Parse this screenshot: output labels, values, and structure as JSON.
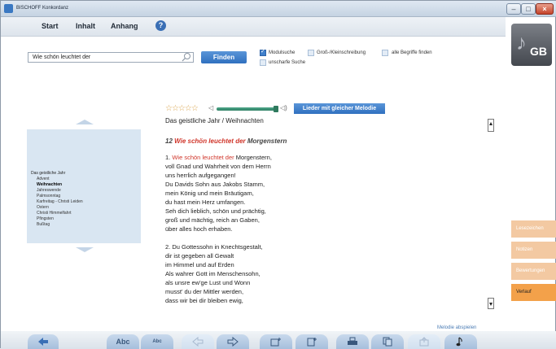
{
  "window": {
    "title": "BISCHOFF Konkordanz"
  },
  "menu": {
    "start": "Start",
    "inhalt": "Inhalt",
    "anhang": "Anhang"
  },
  "logo": {
    "text": "GB"
  },
  "search": {
    "value": "Wie schön leuchtet der",
    "find_label": "Finden"
  },
  "options": {
    "modulsuche": "Modulsuche",
    "gross_klein": "Groß-/Kleinschreibung",
    "alle_begriffe": "alle Begriffe finden",
    "unscharfe": "unscharfe Suche"
  },
  "sidebar": {
    "heading": "Das geistliche Jahr",
    "items": [
      {
        "label": "Advent",
        "active": false
      },
      {
        "label": "Weihnachten",
        "active": true
      },
      {
        "label": "Jahreswende",
        "active": false
      },
      {
        "label": "Palmsonntag",
        "active": false
      },
      {
        "label": "Karfreitag - Christi Leiden",
        "active": false
      },
      {
        "label": "Ostern",
        "active": false
      },
      {
        "label": "Christi Himmelfahrt",
        "active": false
      },
      {
        "label": "Pfingsten",
        "active": false
      },
      {
        "label": "Bußtag",
        "active": false
      }
    ]
  },
  "player": {
    "rating_stars": "☆☆☆☆☆",
    "rating_value": 0,
    "volume": 0.9,
    "melody_button": "Lieder mit gleicher Melodie"
  },
  "hymn": {
    "breadcrumb": "Das geistliche Jahr / Weihnachten",
    "number": "12",
    "title_highlight": "Wie schön leuchtet der",
    "title_rest": "Morgenstern",
    "verse1": [
      {
        "pre": "1. ",
        "hl": "Wie schön leuchtet der",
        "post": " Morgenstern,"
      },
      {
        "pre": "voll Gnad und Wahrheit von dem Herrn",
        "hl": "",
        "post": ""
      },
      {
        "pre": "uns herrlich aufgegangen!",
        "hl": "",
        "post": ""
      },
      {
        "pre": "Du Davids Sohn aus Jakobs Stamm,",
        "hl": "",
        "post": ""
      },
      {
        "pre": "mein König und mein Bräutigam,",
        "hl": "",
        "post": ""
      },
      {
        "pre": "du hast mein Herz umfangen.",
        "hl": "",
        "post": ""
      },
      {
        "pre": "Seh dich lieblich, schön und prächtig,",
        "hl": "",
        "post": ""
      },
      {
        "pre": "groß und mächtig, reich an Gaben,",
        "hl": "",
        "post": ""
      },
      {
        "pre": "über alles hoch erhaben.",
        "hl": "",
        "post": ""
      }
    ],
    "verse2": [
      "2. Du Gottessohn in Knechtsgestalt,",
      "dir ist gegeben all Gewalt",
      "im Himmel und auf Erden",
      "Als wahrer Gott im Menschensohn,",
      "als unsre ew'ge Lust und Wonn",
      "musst' du der Mittler werden,",
      "dass wir bei dir bleiben ewig,"
    ]
  },
  "side_tabs": [
    {
      "label": "Lesezeichen",
      "active": false
    },
    {
      "label": "Notizen",
      "active": false
    },
    {
      "label": "Bewertungen",
      "active": false
    },
    {
      "label": "Verlauf",
      "active": true
    }
  ],
  "bottom": {
    "melody_link": "Melodie abspielen",
    "font_large": "Abc",
    "font_small": "Abc"
  }
}
